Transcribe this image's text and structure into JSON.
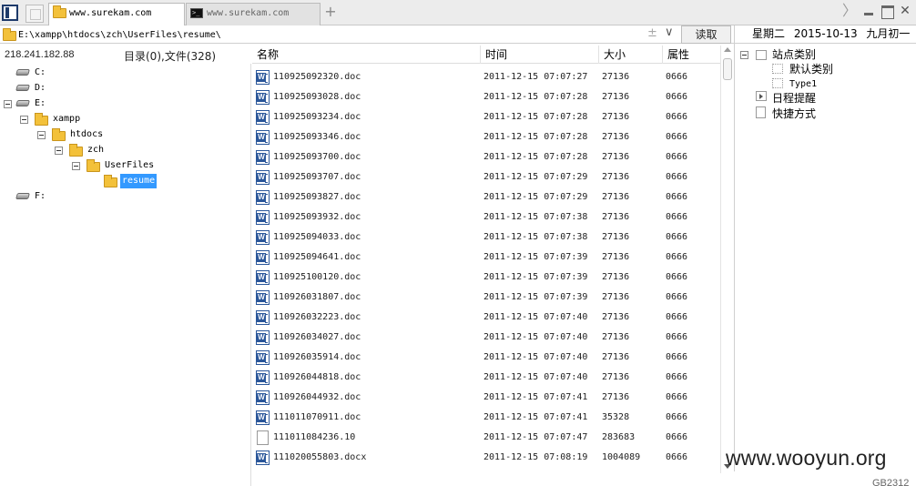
{
  "tabs": [
    {
      "label": "www.surekam.com",
      "active": true,
      "icon": "folder-icon"
    },
    {
      "label": "www.surekam.com",
      "active": false,
      "icon": "terminal-icon"
    }
  ],
  "toolbar": {
    "new_tab_label": "+",
    "chevron_label": "〉",
    "close_label": "✕"
  },
  "address": {
    "path": "E:\\xampp\\htdocs\\zch\\UserFiles\\resume\\",
    "clear_label": "±",
    "dropdown_label": "∨",
    "read_button_label": "读取"
  },
  "status": {
    "ip": "218.241.182.88",
    "counts": "目录(0),文件(328)"
  },
  "date_header": {
    "weekday": "星期二",
    "date": "2015-10-13",
    "lunar": "九月初一"
  },
  "tree": [
    {
      "label": "C:",
      "type": "drive",
      "level": 0,
      "expanded": false,
      "selected": false
    },
    {
      "label": "D:",
      "type": "drive",
      "level": 0,
      "expanded": false,
      "selected": false
    },
    {
      "label": "E:",
      "type": "drive",
      "level": 0,
      "expanded": true,
      "selected": false
    },
    {
      "label": "xampp",
      "type": "folder",
      "level": 1,
      "expanded": true,
      "selected": false
    },
    {
      "label": "htdocs",
      "type": "folder",
      "level": 2,
      "expanded": true,
      "selected": false
    },
    {
      "label": "zch",
      "type": "folder",
      "level": 3,
      "expanded": true,
      "selected": false
    },
    {
      "label": "UserFiles",
      "type": "folder",
      "level": 4,
      "expanded": true,
      "selected": false
    },
    {
      "label": "resume",
      "type": "folder",
      "level": 5,
      "expanded": false,
      "selected": true
    },
    {
      "label": "F:",
      "type": "drive",
      "level": 0,
      "expanded": false,
      "selected": false
    }
  ],
  "columns": {
    "name": "名称",
    "time": "时间",
    "size": "大小",
    "attr": "属性"
  },
  "files": [
    {
      "name": "110925092320.doc",
      "time": "2011-12-15 07:07:27",
      "size": "27136",
      "attr": "0666",
      "icon": "word"
    },
    {
      "name": "110925093028.doc",
      "time": "2011-12-15 07:07:28",
      "size": "27136",
      "attr": "0666",
      "icon": "word"
    },
    {
      "name": "110925093234.doc",
      "time": "2011-12-15 07:07:28",
      "size": "27136",
      "attr": "0666",
      "icon": "word"
    },
    {
      "name": "110925093346.doc",
      "time": "2011-12-15 07:07:28",
      "size": "27136",
      "attr": "0666",
      "icon": "word"
    },
    {
      "name": "110925093700.doc",
      "time": "2011-12-15 07:07:28",
      "size": "27136",
      "attr": "0666",
      "icon": "word"
    },
    {
      "name": "110925093707.doc",
      "time": "2011-12-15 07:07:29",
      "size": "27136",
      "attr": "0666",
      "icon": "word"
    },
    {
      "name": "110925093827.doc",
      "time": "2011-12-15 07:07:29",
      "size": "27136",
      "attr": "0666",
      "icon": "word"
    },
    {
      "name": "110925093932.doc",
      "time": "2011-12-15 07:07:38",
      "size": "27136",
      "attr": "0666",
      "icon": "word"
    },
    {
      "name": "110925094033.doc",
      "time": "2011-12-15 07:07:38",
      "size": "27136",
      "attr": "0666",
      "icon": "word"
    },
    {
      "name": "110925094641.doc",
      "time": "2011-12-15 07:07:39",
      "size": "27136",
      "attr": "0666",
      "icon": "word"
    },
    {
      "name": "110925100120.doc",
      "time": "2011-12-15 07:07:39",
      "size": "27136",
      "attr": "0666",
      "icon": "word"
    },
    {
      "name": "110926031807.doc",
      "time": "2011-12-15 07:07:39",
      "size": "27136",
      "attr": "0666",
      "icon": "word"
    },
    {
      "name": "110926032223.doc",
      "time": "2011-12-15 07:07:40",
      "size": "27136",
      "attr": "0666",
      "icon": "word"
    },
    {
      "name": "110926034027.doc",
      "time": "2011-12-15 07:07:40",
      "size": "27136",
      "attr": "0666",
      "icon": "word"
    },
    {
      "name": "110926035914.doc",
      "time": "2011-12-15 07:07:40",
      "size": "27136",
      "attr": "0666",
      "icon": "word"
    },
    {
      "name": "110926044818.doc",
      "time": "2011-12-15 07:07:40",
      "size": "27136",
      "attr": "0666",
      "icon": "word"
    },
    {
      "name": "110926044932.doc",
      "time": "2011-12-15 07:07:41",
      "size": "27136",
      "attr": "0666",
      "icon": "word"
    },
    {
      "name": "111011070911.doc",
      "time": "2011-12-15 07:07:41",
      "size": "35328",
      "attr": "0666",
      "icon": "word"
    },
    {
      "name": "111011084236.10",
      "time": "2011-12-15 07:07:47",
      "size": "283683",
      "attr": "0666",
      "icon": "blank"
    },
    {
      "name": "111020055803.docx",
      "time": "2011-12-15 07:08:19",
      "size": "1004089",
      "attr": "0666",
      "icon": "word"
    }
  ],
  "right_panel": {
    "site_category": "站点类别",
    "default_category": "默认类别",
    "type1": "Type1",
    "schedule": "日程提醒",
    "shortcuts": "快捷方式"
  },
  "watermark": "www.wooyun.org",
  "encoding": "GB2312"
}
